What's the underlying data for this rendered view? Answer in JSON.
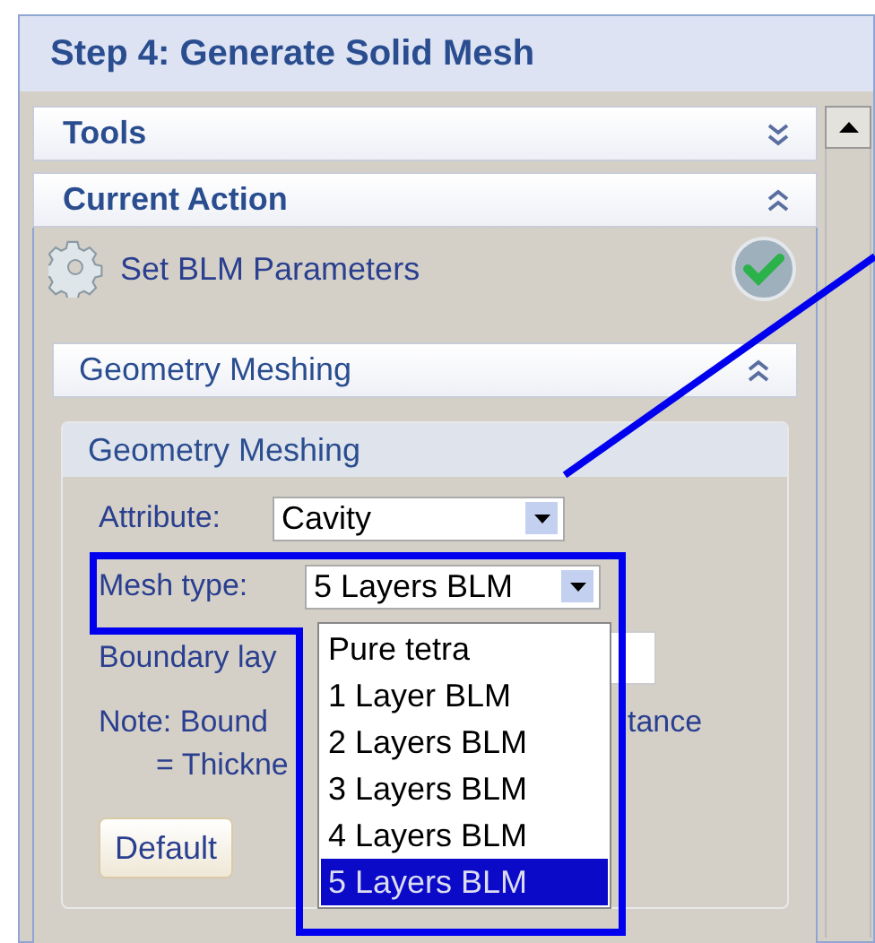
{
  "title": "Step 4: Generate Solid Mesh",
  "sections": [
    {
      "label": "Tools",
      "expanded": false
    },
    {
      "label": "Current Action",
      "expanded": true
    }
  ],
  "action": {
    "label": "Set BLM Parameters",
    "done": true
  },
  "subsection": {
    "label": "Geometry Meshing",
    "expanded": true
  },
  "group": {
    "title": "Geometry Meshing",
    "attribute": {
      "label": "Attribute:",
      "value": "Cavity"
    },
    "mesh_type": {
      "label": "Mesh type:",
      "value": "5 Layers BLM",
      "open": true,
      "options": [
        {
          "label": "Pure tetra",
          "selected": false
        },
        {
          "label": "1 Layer BLM",
          "selected": false
        },
        {
          "label": "2 Layers BLM",
          "selected": false
        },
        {
          "label": "3 Layers BLM",
          "selected": false
        },
        {
          "label": "4 Layers BLM",
          "selected": false
        },
        {
          "label": "5 Layers BLM",
          "selected": true
        }
      ]
    },
    "boundary_label": "Boundary lay",
    "note_start": "Note: Bound",
    "note_end": "tance",
    "note_line2": "= Thickne",
    "button": "Default"
  }
}
